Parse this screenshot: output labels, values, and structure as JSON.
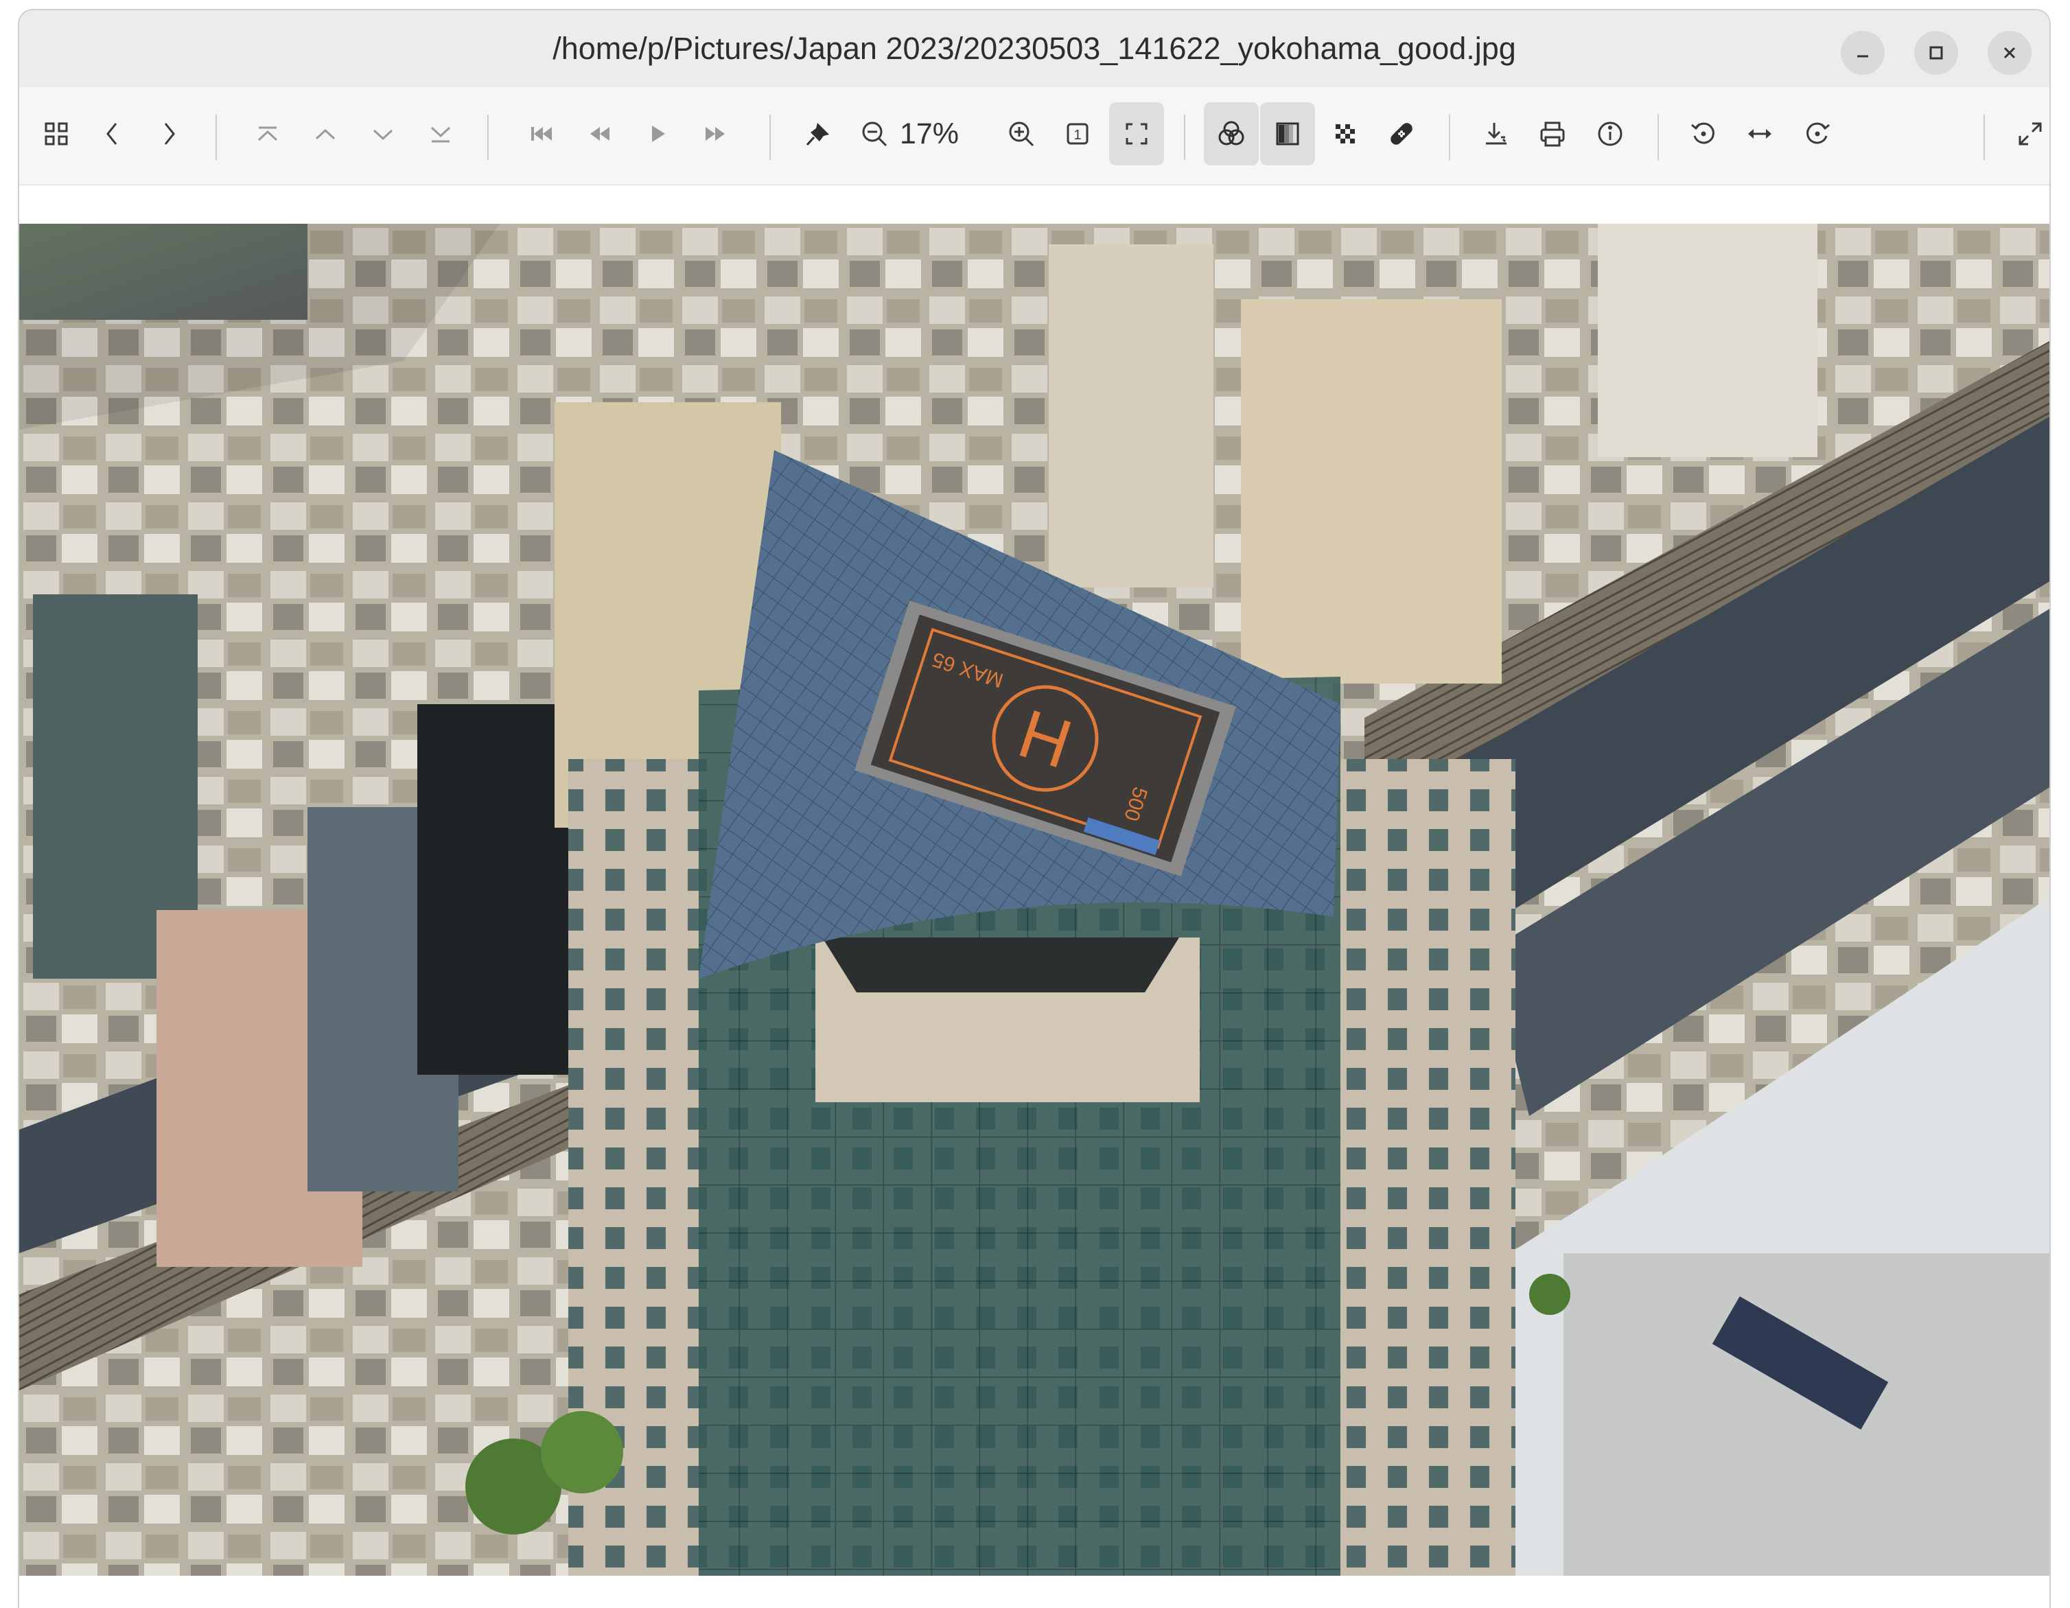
{
  "window": {
    "title": "/home/p/Pictures/Japan 2023/20230503_141622_yokohama_good.jpg",
    "controls": [
      "minimize-icon",
      "maximize-icon",
      "close-icon"
    ]
  },
  "toolbar": {
    "zoom_value": "17%",
    "actual_size_label": "1",
    "buttons": [
      "grid-icon",
      "chevron-left-icon",
      "chevron-right-icon",
      "first-page-icon",
      "page-up-icon",
      "page-down-icon",
      "last-page-icon",
      "skip-first-icon",
      "rewind-icon",
      "play-icon",
      "fast-forward-icon",
      "pin-icon",
      "zoom-out-icon",
      "zoom-in-icon",
      "actual-size-icon",
      "fit-window-icon",
      "color-channels-icon",
      "grayscale-icon",
      "checkerboard-icon",
      "bandage-icon",
      "save-icon",
      "print-icon",
      "info-icon",
      "rotate-left-icon",
      "flip-horizontal-icon",
      "rotate-right-icon",
      "fullscreen-icon"
    ]
  },
  "image": {
    "helipad_sign": "MAX 65",
    "helipad_number": "500"
  },
  "colors": {
    "titlebar": "#ececec",
    "toolbar": "#f6f6f6",
    "active_button": "#dedede",
    "icon": "#3a3a3a",
    "helipad_markings": "#e07a38"
  }
}
